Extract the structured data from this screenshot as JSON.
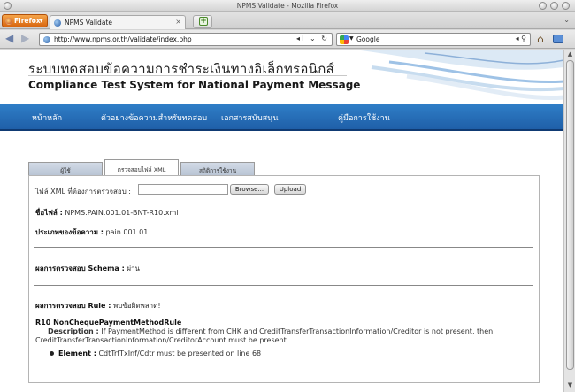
{
  "window": {
    "title": "NPMS Validate - Mozilla Firefox"
  },
  "firefox_button": {
    "label": "Firefox"
  },
  "tabs": [
    {
      "label": "NPMS Validate"
    }
  ],
  "navbar": {
    "url": "http://www.npms.or.th/validate/index.php",
    "search_engine": "Google"
  },
  "page": {
    "title_thai": "ระบบทดสอบข้อความการชำระเงินทางอิเล็กทรอนิกส์",
    "title_eng": "Compliance Test System for National Payment Message",
    "nav": [
      {
        "label": "หน้าหลัก"
      },
      {
        "label": "ตัวอย่างข้อความสำหรับทดสอบ"
      },
      {
        "label": "เอกสารสนับสนุน"
      },
      {
        "label": "คู่มือการใช้งาน"
      }
    ],
    "content_tabs": [
      {
        "label": "ผู้ใช้"
      },
      {
        "label": "ตรวจสอบไฟล์ XML"
      },
      {
        "label": "สถิติการใช้งาน"
      }
    ],
    "upload": {
      "label": "ไฟล์ XML ที่ต้องการตรวจสอบ :",
      "browse_label": "Browse...",
      "upload_label": "Upload"
    },
    "filename": {
      "label": "ชื่อไฟล์ :",
      "value": "NPMS.PAIN.001.01-BNT-R10.xml"
    },
    "message_type": {
      "label": "ประเภทของข้อความ :",
      "value": "pain.001.01"
    },
    "schema_result": {
      "label": "ผลการตรวจสอบ Schema :",
      "value": "ผ่าน"
    },
    "rule_result": {
      "label": "ผลการตรวจสอบ Rule :",
      "value": "พบข้อผิดพลาด!"
    },
    "rule": {
      "name": "R10 NonChequePaymentMethodRule",
      "description_label": "Description :",
      "description": "If PaymentMethod is different from CHK and CreditTransferTransactionInformation/Creditor is not present, then CreditTransferTransactionInformation/CreditorAccount must be present.",
      "element_label": "Element :",
      "element_text": "CdtTrfTxInf/Cdtr must be presented on line 68"
    }
  }
}
